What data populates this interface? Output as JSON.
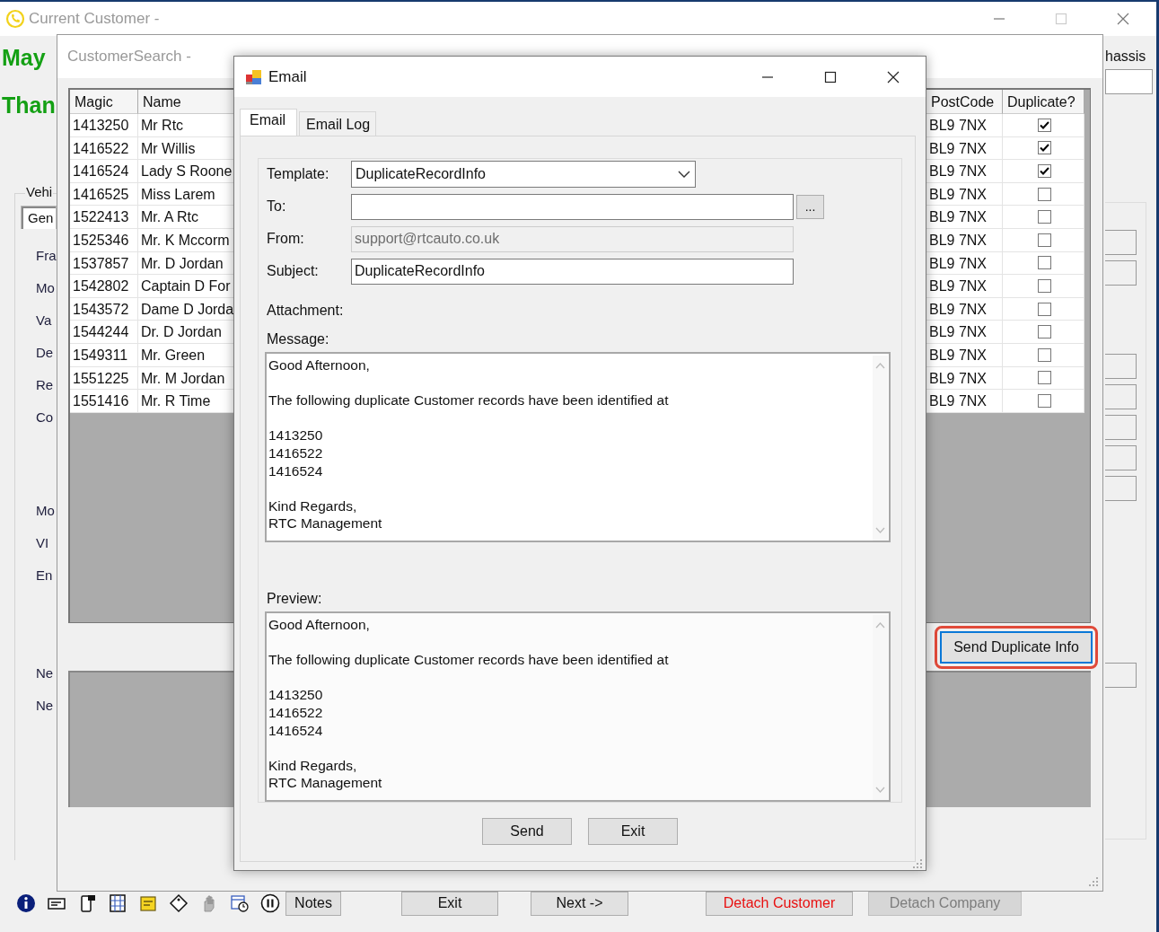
{
  "main_window": {
    "title": "Current Customer -",
    "headings": [
      "May",
      "Than"
    ],
    "vehicle_group": {
      "label": "Vehi",
      "tabs": [
        {
          "label": "Gen",
          "selected": true
        }
      ],
      "label_groups": [
        [
          "Fra",
          "Mo",
          "Va",
          "De",
          "Re",
          "Co"
        ],
        [
          "Mo",
          "VI",
          "En"
        ],
        [
          "Ne",
          "Ne"
        ]
      ]
    },
    "side_label": "hassis",
    "notes_button": "Notes",
    "buttons": [
      {
        "label": "Exit",
        "kind": "normal",
        "disabled": false
      },
      {
        "label": "Next ->",
        "kind": "normal",
        "disabled": false
      },
      {
        "label": "Detach Customer",
        "kind": "danger",
        "disabled": false
      },
      {
        "label": "Detach Company",
        "kind": "normal",
        "disabled": true
      }
    ]
  },
  "customer_search": {
    "title": "CustomerSearch -",
    "columns": [
      "Magic",
      "Name",
      "PostCode",
      "Duplicate?"
    ],
    "rows": [
      {
        "magic": "1413250",
        "name": "Mr Rtc",
        "postcode": "BL9 7NX",
        "duplicate": true
      },
      {
        "magic": "1416522",
        "name": "Mr Willis",
        "postcode": "BL9 7NX",
        "duplicate": true
      },
      {
        "magic": "1416524",
        "name": "Lady S Roone",
        "postcode": "BL9 7NX",
        "duplicate": true
      },
      {
        "magic": "1416525",
        "name": "Miss Larem",
        "postcode": "BL9 7NX",
        "duplicate": false
      },
      {
        "magic": "1522413",
        "name": "Mr. A Rtc",
        "postcode": "BL9 7NX",
        "duplicate": false
      },
      {
        "magic": "1525346",
        "name": "Mr. K Mccorm",
        "postcode": "BL9 7NX",
        "duplicate": false
      },
      {
        "magic": "1537857",
        "name": "Mr. D Jordan",
        "postcode": "BL9 7NX",
        "duplicate": false
      },
      {
        "magic": "1542802",
        "name": "Captain D For",
        "postcode": "BL9 7NX",
        "duplicate": false
      },
      {
        "magic": "1543572",
        "name": "Dame D Jorda",
        "postcode": "BL9 7NX",
        "duplicate": false
      },
      {
        "magic": "1544244",
        "name": "Dr. D Jordan",
        "postcode": "BL9 7NX",
        "duplicate": false
      },
      {
        "magic": "1549311",
        "name": "Mr. Green",
        "postcode": "BL9 7NX",
        "duplicate": false
      },
      {
        "magic": "1551225",
        "name": "Mr. M Jordan",
        "postcode": "BL9 7NX",
        "duplicate": false
      },
      {
        "magic": "1551416",
        "name": "Mr. R Time",
        "postcode": "BL9 7NX",
        "duplicate": false
      }
    ],
    "send_button": {
      "label": "Send Duplicate Info",
      "highlighted": true
    }
  },
  "email": {
    "title": "Email",
    "tabs": [
      {
        "label": "Email",
        "selected": true
      },
      {
        "label": "Email Log",
        "selected": false
      }
    ],
    "template": {
      "label": "Template:",
      "value": "DuplicateRecordInfo"
    },
    "to": {
      "label": "To:"
    },
    "browse_button": "...",
    "from": {
      "label": "From:",
      "value": "support@rtcauto.co.uk",
      "disabled": true
    },
    "subject": {
      "label": "Subject:",
      "value": "DuplicateRecordInfo"
    },
    "attachment_label": "Attachment:",
    "message": {
      "label": "Message:",
      "paragraphs": [
        "Good Afternoon,",
        "The following duplicate Customer records have been identified at",
        "1413250\n1416522\n1416524",
        "Kind Regards,\nRTC Management"
      ]
    },
    "preview": {
      "label": "Preview:",
      "paragraphs": [
        "Good Afternoon,",
        "The following duplicate Customer records have been identified at",
        "1413250\n1416522\n1416524",
        "Kind Regards,\nRTC Management"
      ]
    },
    "buttons": [
      "Send",
      "Exit"
    ]
  }
}
